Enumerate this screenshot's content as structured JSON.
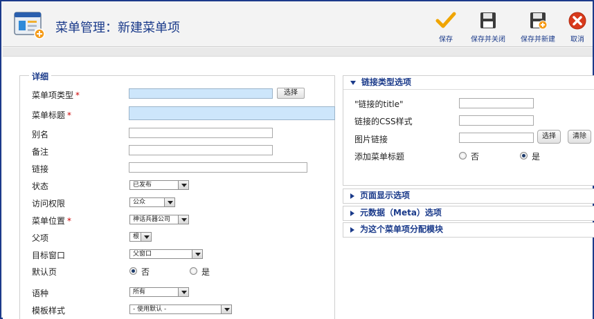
{
  "header": {
    "title": "菜单管理：新建菜单项",
    "toolbar": {
      "save": "保存",
      "save_close": "保存并关闭",
      "save_new": "保存并新建",
      "cancel": "取消"
    }
  },
  "details": {
    "legend": "详细",
    "fields": {
      "item_type": {
        "label": "菜单项类型",
        "button": "选择"
      },
      "title": {
        "label": "菜单标题"
      },
      "alias": {
        "label": "别名"
      },
      "note": {
        "label": "备注"
      },
      "link": {
        "label": "链接"
      },
      "status": {
        "label": "状态",
        "value": "已发布"
      },
      "access": {
        "label": "访问权限",
        "value": "公众"
      },
      "menu_location": {
        "label": "菜单位置",
        "value": "神话兵器公司"
      },
      "parent": {
        "label": "父项",
        "value": "根"
      },
      "target_window": {
        "label": "目标窗口",
        "value": "父窗口"
      },
      "default_page": {
        "label": "默认页",
        "options": [
          "否",
          "是"
        ],
        "selected": "否"
      },
      "language": {
        "label": "语种",
        "value": "所有"
      },
      "template_style": {
        "label": "模板样式",
        "value": "- 使用默认 -"
      }
    }
  },
  "link_options": {
    "heading": "链接类型选项",
    "fields": {
      "link_title": {
        "label": "\"链接的title\""
      },
      "link_css": {
        "label": "链接的CSS样式"
      },
      "image_link": {
        "label": "图片链接",
        "select": "选择",
        "clear": "清除"
      },
      "add_menu_title": {
        "label": "添加菜单标题",
        "options": [
          "否",
          "是"
        ],
        "selected": "是"
      }
    }
  },
  "collapsed_panels": [
    {
      "heading": "页面显示选项"
    },
    {
      "heading": "元数据（Meta）选项"
    },
    {
      "heading": "为这个菜单项分配模块"
    }
  ],
  "colors": {
    "accent": "#1a3a8a",
    "required": "#cc0000",
    "highlight_input": "#cde6fb",
    "save_icon": "#f0a500",
    "cancel_icon": "#d83a1c"
  }
}
